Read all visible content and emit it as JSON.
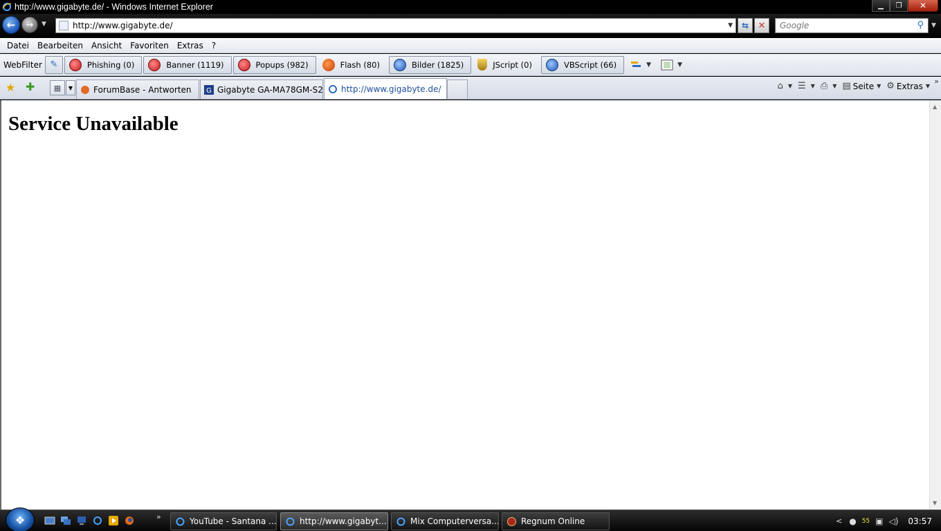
{
  "window": {
    "title": "http://www.gigabyte.de/ - Windows Internet Explorer"
  },
  "navigation": {
    "address_value": "http://www.gigabyte.de/",
    "search_placeholder": "Google"
  },
  "menu": {
    "items": [
      "Datei",
      "Bearbeiten",
      "Ansicht",
      "Favoriten",
      "Extras",
      "?"
    ]
  },
  "webfilter": {
    "label": "WebFilter",
    "buttons": [
      {
        "label": "Phishing (0)",
        "icon": "block-icon"
      },
      {
        "label": "Banner (1119)",
        "icon": "block-icon"
      },
      {
        "label": "Popups (982)",
        "icon": "block-icon"
      },
      {
        "label": "Flash (80)",
        "icon": "flash-icon"
      },
      {
        "label": "Bilder (1825)",
        "icon": "block-icon"
      },
      {
        "label": "JScript (0)",
        "icon": "shield-icon"
      },
      {
        "label": "VBScript (66)",
        "icon": "block-icon"
      }
    ]
  },
  "tabs": [
    {
      "label": "ForumBase - Antworten",
      "active": false
    },
    {
      "label": "Gigabyte GA-MA78GM-S2...",
      "active": false
    },
    {
      "label": "http://www.gigabyte.de/",
      "active": true
    }
  ],
  "commandbar": {
    "page_label": "Seite",
    "tools_label": "Extras"
  },
  "content": {
    "heading": "Service Unavailable"
  },
  "taskbar": {
    "tasks": [
      {
        "label": "YouTube - Santana ...",
        "active": false
      },
      {
        "label": "http://www.gigabyt...",
        "active": true
      },
      {
        "label": "Mix Computerversa...",
        "active": false
      },
      {
        "label": "Regnum Online",
        "active": false
      }
    ],
    "tray_number": "55",
    "clock": "03:57"
  },
  "colors": {
    "titlebar": "#000000",
    "active_tab_text": "#1f4e9a",
    "close_button": "#c43a1f"
  }
}
